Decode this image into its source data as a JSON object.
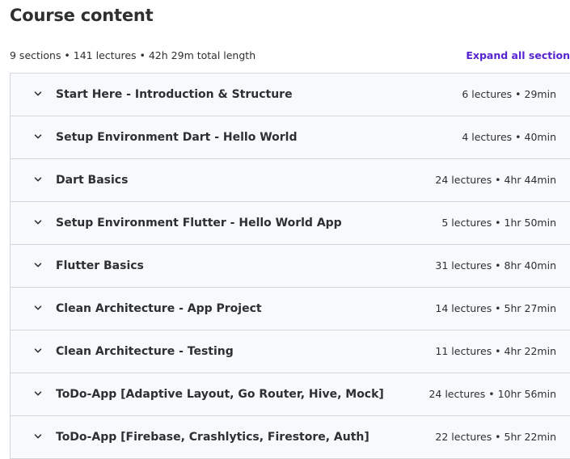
{
  "header": {
    "title": "Course content",
    "summary": "9 sections • 141 lectures • 42h 29m total length",
    "expand_all_label": "Expand all section"
  },
  "colors": {
    "accent": "#5624d0",
    "text": "#2d2f31",
    "row_background": "#f7f9fa",
    "border": "#d1d7dc"
  },
  "sections": [
    {
      "title": "Start Here - Introduction & Structure",
      "meta": "6 lectures • 29min",
      "icon": "chevron-down-icon"
    },
    {
      "title": "Setup Environment Dart - Hello World",
      "meta": "4 lectures • 40min",
      "icon": "chevron-down-icon"
    },
    {
      "title": "Dart Basics",
      "meta": "24 lectures • 4hr 44min",
      "icon": "chevron-down-icon"
    },
    {
      "title": "Setup Environment Flutter - Hello World App",
      "meta": "5 lectures • 1hr 50min",
      "icon": "chevron-down-icon"
    },
    {
      "title": "Flutter Basics",
      "meta": "31 lectures • 8hr 40min",
      "icon": "chevron-down-icon"
    },
    {
      "title": "Clean Architecture - App Project",
      "meta": "14 lectures • 5hr 27min",
      "icon": "chevron-down-icon"
    },
    {
      "title": "Clean Architecture - Testing",
      "meta": "11 lectures • 4hr 22min",
      "icon": "chevron-down-icon"
    },
    {
      "title": "ToDo-App [Adaptive Layout, Go Router, Hive, Mock]",
      "meta": "24 lectures • 10hr 56min",
      "icon": "chevron-down-icon"
    },
    {
      "title": "ToDo-App [Firebase, Crashlytics, Firestore, Auth]",
      "meta": "22 lectures • 5hr 22min",
      "icon": "chevron-down-icon"
    }
  ]
}
